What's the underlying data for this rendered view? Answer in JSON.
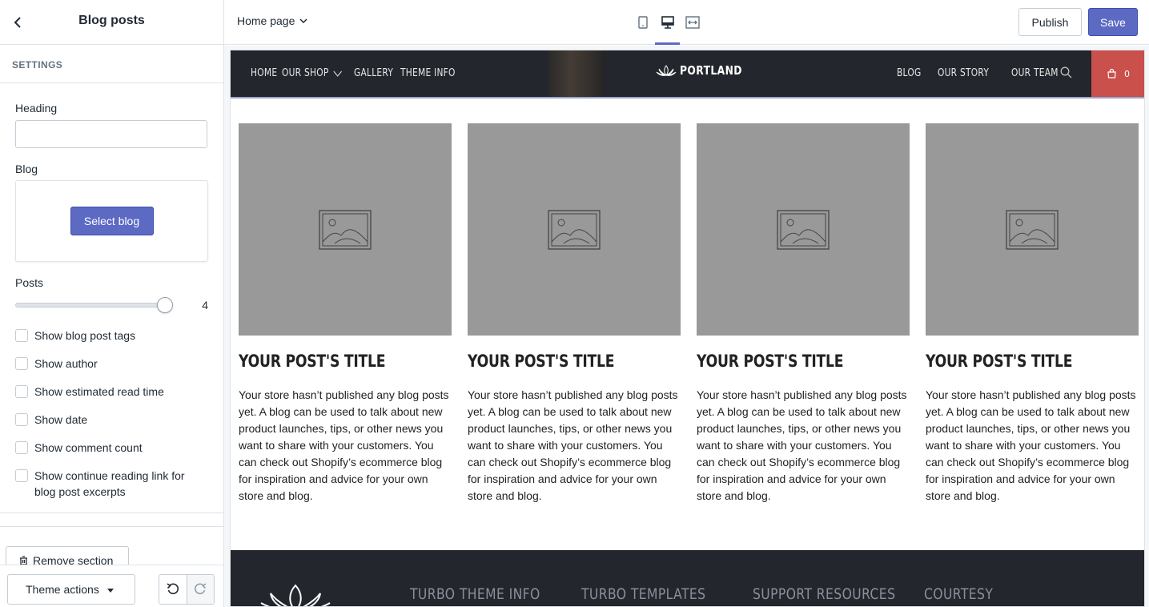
{
  "sidebar": {
    "title": "Blog posts",
    "section_label": "SETTINGS",
    "heading_label": "Heading",
    "heading_value": "",
    "blog_label": "Blog",
    "select_blog_label": "Select blog",
    "posts_label": "Posts",
    "posts_value": "4",
    "posts_level_fraction": 1.0,
    "checkboxes": [
      {
        "label": "Show blog post tags",
        "checked": false
      },
      {
        "label": "Show author",
        "checked": false
      },
      {
        "label": "Show estimated read time",
        "checked": false
      },
      {
        "label": "Show date",
        "checked": false
      },
      {
        "label": "Show comment count",
        "checked": false
      },
      {
        "label": "Show continue reading link for blog post excerpts",
        "checked": false
      }
    ],
    "remove_section_label": "Remove section",
    "theme_actions_label": "Theme actions"
  },
  "topbar": {
    "page_selector": "Home page",
    "publish_label": "Publish",
    "save_label": "Save",
    "active_view": "desktop"
  },
  "preview": {
    "nav": {
      "left_items": [
        "HOME",
        "OUR SHOP",
        "GALLERY",
        "THEME INFO"
      ],
      "logo_text": "PORTLAND",
      "right_items": [
        "BLOG",
        "OUR STORY",
        "OUR TEAM"
      ],
      "cart_count": "0"
    },
    "posts": [
      {
        "title": "YOUR POST'S TITLE",
        "excerpt": "Your store hasn’t published any blog posts yet. A blog can be used to talk about new product launches, tips, or other news you want to share with your customers. You can check out Shopify’s ecommerce blog for inspiration and advice for your own store and blog."
      },
      {
        "title": "YOUR POST'S TITLE",
        "excerpt": "Your store hasn’t published any blog posts yet. A blog can be used to talk about new product launches, tips, or other news you want to share with your customers. You can check out Shopify’s ecommerce blog for inspiration and advice for your own store and blog."
      },
      {
        "title": "YOUR POST'S TITLE",
        "excerpt": "Your store hasn’t published any blog posts yet. A blog can be used to talk about new product launches, tips, or other news you want to share with your customers. You can check out Shopify’s ecommerce blog for inspiration and advice for your own store and blog."
      },
      {
        "title": "YOUR POST'S TITLE",
        "excerpt": "Your store hasn’t published any blog posts yet. A blog can be used to talk about new product launches, tips, or other news you want to share with your customers. You can check out Shopify’s ecommerce blog for inspiration and advice for your own store and blog."
      }
    ],
    "footer_headings": [
      "TURBO THEME INFO",
      "TURBO TEMPLATES",
      "SUPPORT RESOURCES",
      "COURTESY"
    ]
  },
  "colors": {
    "accent": "#5c6ac4",
    "nav_bg": "#23262d",
    "cart_bg": "#c9504b",
    "placeholder_bg": "#999999"
  },
  "icons": [
    "back-arrow-icon",
    "chevron-down-icon",
    "mobile-view-icon",
    "desktop-view-icon",
    "fullscreen-view-icon",
    "lotus-logo-icon",
    "search-icon",
    "shopping-bag-icon",
    "image-placeholder-icon",
    "trash-icon",
    "caret-down-icon",
    "undo-icon",
    "redo-icon"
  ]
}
